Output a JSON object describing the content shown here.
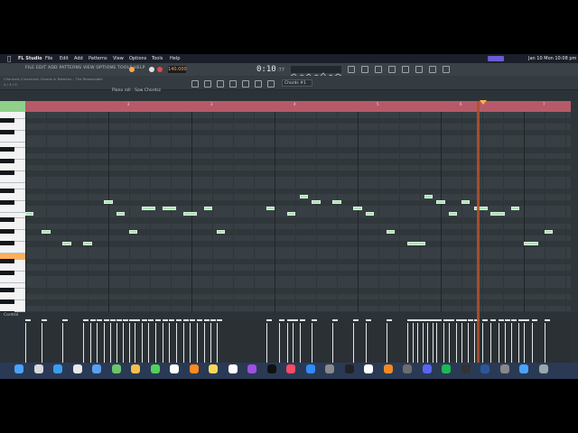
{
  "menubar": {
    "app_name": "FL Studio",
    "menus": [
      "File",
      "Edit",
      "Add",
      "Patterns",
      "View",
      "Options",
      "Tools",
      "Help"
    ],
    "datetime": "Jan 10 Mon  10:08 pm"
  },
  "fl": {
    "menu_text": "FILE EDIT ADD PATTERNS VIEW OPTIONS TOOLS HELP",
    "hint_text": "Channels (Channels) Chords in Ramirez – The Reasonable",
    "hint_text2": "4 / 4 / 0",
    "tempo": "140.000",
    "clock": "0:10",
    "clock_ms": ":77",
    "chords_label": "Chords #1",
    "piano_roll_title": "Piano roll - Saw Chordsz",
    "ruler_marks": [
      "2",
      "3",
      "4",
      "5",
      "6",
      "7"
    ],
    "control_label": "Control"
  },
  "colors": {
    "note": "#a8e2b0",
    "ruler": "#b65a68",
    "playhead": "#b24f2a",
    "key_highlight": "#ffaf5c"
  },
  "notes": [
    {
      "time": 0.0,
      "len": 0.1,
      "pitch": 0
    },
    {
      "time": 0.2,
      "len": 0.1,
      "pitch": -3
    },
    {
      "time": 0.45,
      "len": 0.1,
      "pitch": -5
    },
    {
      "time": 0.7,
      "len": 0.1,
      "pitch": -5
    },
    {
      "time": 0.95,
      "len": 0.1,
      "pitch": 2
    },
    {
      "time": 1.1,
      "len": 0.1,
      "pitch": 0
    },
    {
      "time": 1.25,
      "len": 0.1,
      "pitch": -3
    },
    {
      "time": 1.4,
      "len": 0.17,
      "pitch": 1
    },
    {
      "time": 1.65,
      "len": 0.17,
      "pitch": 1
    },
    {
      "time": 1.9,
      "len": 0.17,
      "pitch": 0
    },
    {
      "time": 2.15,
      "len": 0.1,
      "pitch": 1
    },
    {
      "time": 2.3,
      "len": 0.1,
      "pitch": -3
    },
    {
      "time": 2.9,
      "len": 0.1,
      "pitch": 1
    },
    {
      "time": 3.15,
      "len": 0.1,
      "pitch": 0
    },
    {
      "time": 3.3,
      "len": 0.1,
      "pitch": 3
    },
    {
      "time": 3.45,
      "len": 0.1,
      "pitch": 2
    },
    {
      "time": 3.7,
      "len": 0.1,
      "pitch": 2
    },
    {
      "time": 3.95,
      "len": 0.1,
      "pitch": 1
    },
    {
      "time": 4.1,
      "len": 0.1,
      "pitch": 0
    },
    {
      "time": 4.35,
      "len": 0.1,
      "pitch": -3
    },
    {
      "time": 4.6,
      "len": 0.22,
      "pitch": -5
    },
    {
      "time": 4.8,
      "len": 0.1,
      "pitch": 3
    },
    {
      "time": 4.95,
      "len": 0.1,
      "pitch": 2
    },
    {
      "time": 5.1,
      "len": 0.1,
      "pitch": 0
    },
    {
      "time": 5.25,
      "len": 0.1,
      "pitch": 2
    },
    {
      "time": 5.4,
      "len": 0.17,
      "pitch": 1
    },
    {
      "time": 5.6,
      "len": 0.17,
      "pitch": 0
    },
    {
      "time": 5.85,
      "len": 0.1,
      "pitch": 1
    },
    {
      "time": 6.0,
      "len": 0.17,
      "pitch": -5
    },
    {
      "time": 6.25,
      "len": 0.1,
      "pitch": -3
    }
  ],
  "velocity_bars": [
    0.0,
    0.2,
    0.45,
    0.7,
    0.78,
    0.86,
    0.95,
    1.02,
    1.1,
    1.17,
    1.25,
    1.32,
    1.4,
    1.48,
    1.57,
    1.65,
    1.73,
    1.82,
    1.9,
    1.98,
    2.07,
    2.15,
    2.23,
    2.3,
    2.9,
    3.05,
    3.15,
    3.22,
    3.3,
    3.45,
    3.7,
    3.95,
    4.1,
    4.35,
    4.6,
    4.66,
    4.72,
    4.78,
    4.84,
    4.9,
    4.95,
    5.03,
    5.1,
    5.18,
    5.25,
    5.33,
    5.4,
    5.5,
    5.6,
    5.7,
    5.77,
    5.85,
    5.93,
    6.0,
    6.1,
    6.25
  ],
  "playhead_time": 5.43,
  "dock_icons": [
    "finder",
    "launchpad",
    "safari",
    "chrome",
    "mail",
    "maps",
    "photos",
    "messages",
    "calendar",
    "vlc",
    "notes",
    "reminders",
    "podcasts",
    "tv",
    "music",
    "appstore",
    "settings",
    "terminal",
    "notion",
    "flstudio",
    "scripts",
    "discord",
    "spotify",
    "obs",
    "word",
    "ext",
    "dl",
    "trash"
  ]
}
